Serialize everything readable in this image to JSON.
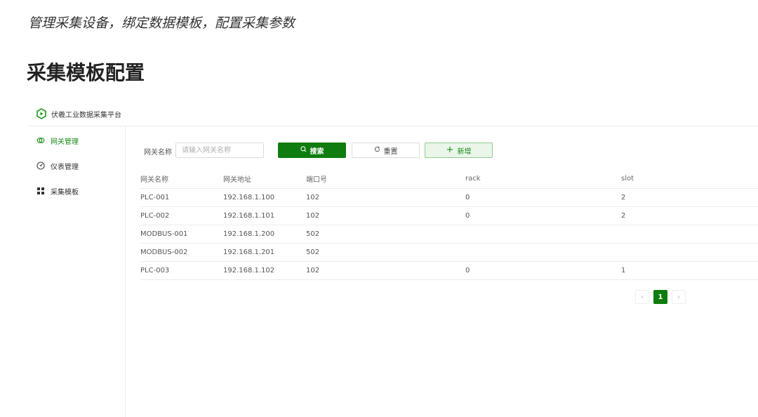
{
  "doc": {
    "subtitle": "管理采集设备，绑定数据模板，配置采集参数",
    "heading": "采集模板配置"
  },
  "app": {
    "title": "伏羲工业数据采集平台",
    "accent_color": "#0e7c0e"
  },
  "sidebar": {
    "items": [
      {
        "label": "网关管理",
        "icon": "gateway-icon",
        "active": true
      },
      {
        "label": "仪表管理",
        "icon": "gauge-icon",
        "active": false
      },
      {
        "label": "采集模板",
        "icon": "grid-icon",
        "active": false
      }
    ]
  },
  "search": {
    "label": "网关名称",
    "placeholder": "请输入网关名称",
    "value": "",
    "search_label": "搜索",
    "reset_label": "重置",
    "add_label": "新增"
  },
  "table": {
    "headers": [
      "网关名称",
      "网关地址",
      "端口号",
      "rack",
      "slot"
    ],
    "rows": [
      [
        "PLC-001",
        "192.168.1.100",
        "102",
        "0",
        "2"
      ],
      [
        "PLC-002",
        "192.168.1.101",
        "102",
        "0",
        "2"
      ],
      [
        "MODBUS-001",
        "192.168.1.200",
        "502",
        "",
        ""
      ],
      [
        "MODBUS-002",
        "192.168.1.201",
        "502",
        "",
        ""
      ],
      [
        "PLC-003",
        "192.168.1.102",
        "102",
        "0",
        "1"
      ]
    ]
  },
  "pagination": {
    "prev": "‹",
    "current": "1",
    "next": "›"
  }
}
